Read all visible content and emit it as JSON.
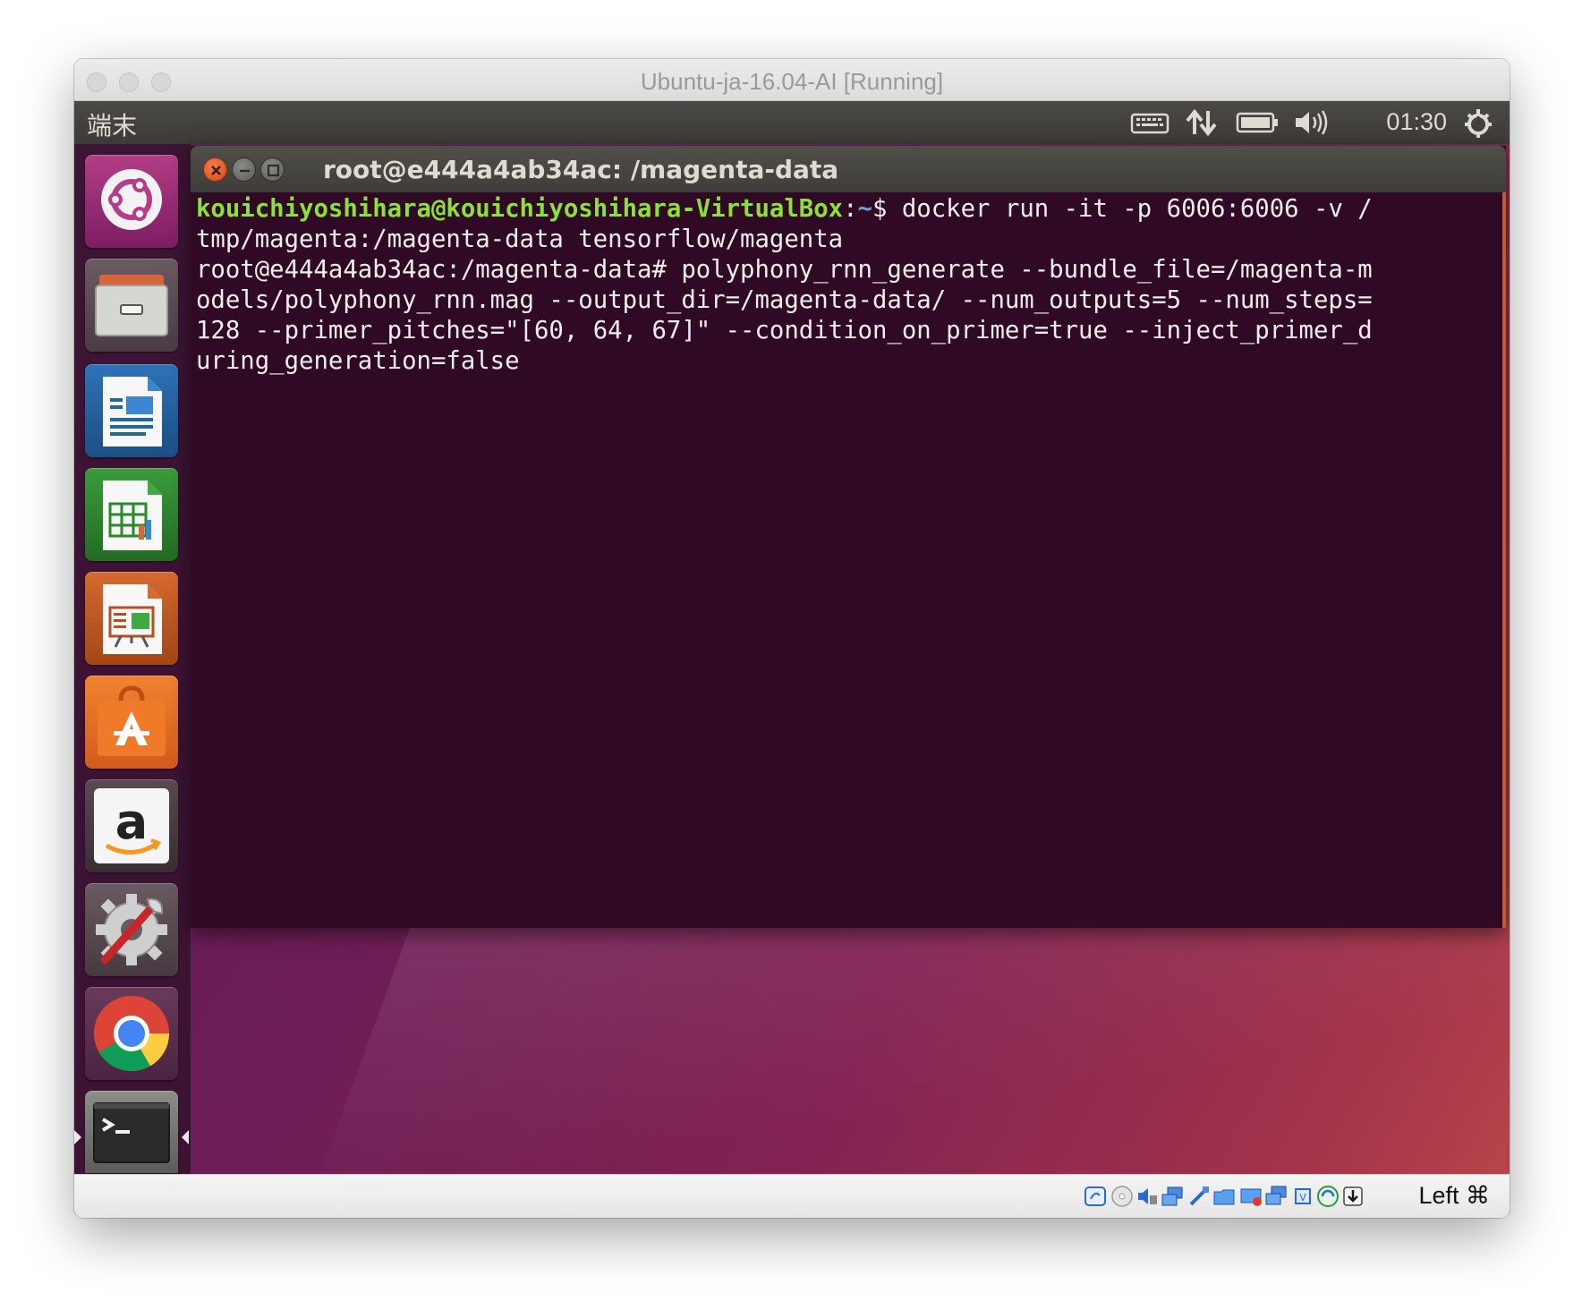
{
  "mac_window": {
    "title": "Ubuntu-ja-16.04-AI [Running]"
  },
  "top_panel": {
    "app_name": "端末",
    "clock": "01:30",
    "indicators": [
      "keyboard-icon",
      "network-updown-icon",
      "battery-icon",
      "volume-icon",
      "power-gear-icon"
    ]
  },
  "launcher": {
    "items": [
      {
        "name": "ubuntu-dash-icon",
        "active": false
      },
      {
        "name": "files-icon",
        "active": false
      },
      {
        "name": "libreoffice-writer-icon",
        "active": false
      },
      {
        "name": "libreoffice-calc-icon",
        "active": false
      },
      {
        "name": "libreoffice-impress-icon",
        "active": false
      },
      {
        "name": "ubuntu-software-icon",
        "active": false
      },
      {
        "name": "amazon-icon",
        "active": false
      },
      {
        "name": "system-settings-icon",
        "active": false
      },
      {
        "name": "chrome-icon",
        "active": false
      },
      {
        "name": "terminal-icon",
        "active": true
      }
    ]
  },
  "terminal": {
    "title": "root@e444a4ab34ac: /magenta-data",
    "prompt1_user": "kouichiyoshihara@kouichiyoshihara-VirtualBox",
    "prompt1_sep": ":",
    "prompt1_path": "~",
    "prompt1_cmd": "$ docker run -it -p 6006:6006 -v /",
    "lines": [
      "tmp/magenta:/magenta-data tensorflow/magenta",
      "root@e444a4ab34ac:/magenta-data# polyphony_rnn_generate --bundle_file=/magenta-m",
      "odels/polyphony_rnn.mag --output_dir=/magenta-data/ --num_outputs=5 --num_steps=",
      "128 --primer_pitches=\"[60, 64, 67]\" --condition_on_primer=true --inject_primer_d",
      "uring_generation=false"
    ]
  },
  "vbox_statusbar": {
    "host_key": "Left ⌘",
    "icons": [
      "hard-disk-icon",
      "optical-disc-icon",
      "audio-icon",
      "network-icon",
      "usb-icon",
      "shared-folders-icon",
      "display-icon",
      "video-capture-icon",
      "cpu-icon",
      "mouse-integration-icon",
      "keyboard-capture-icon"
    ]
  },
  "colors": {
    "terminal_bg": "#300a24",
    "prompt_green": "#8ae234",
    "prompt_blue": "#729fcf",
    "panel_bg": "#3c3b37"
  }
}
